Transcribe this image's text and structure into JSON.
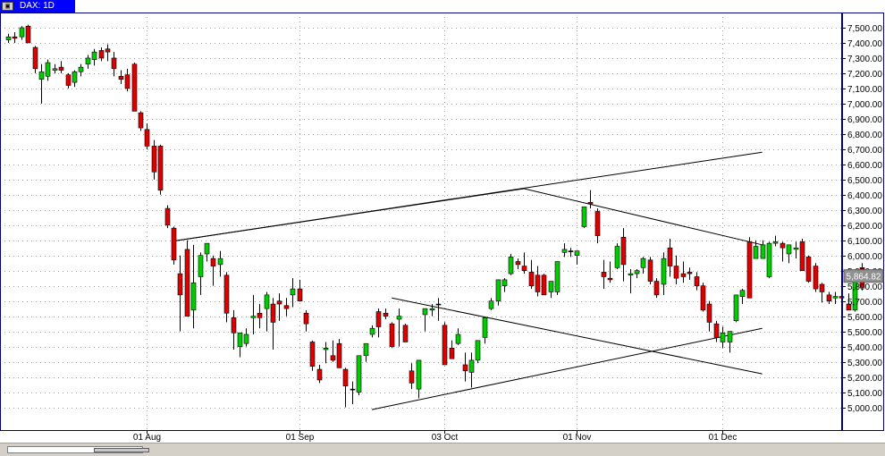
{
  "window": {
    "title": "DAX: 1D"
  },
  "chart_data": {
    "type": "candlestick",
    "title": "DAX: 1D",
    "ylim": [
      4850,
      7600
    ],
    "y_ticks": [
      5000,
      5100,
      5200,
      5300,
      5400,
      5500,
      5600,
      5700,
      5800,
      5900,
      6000,
      6100,
      6200,
      6300,
      6400,
      6500,
      6600,
      6700,
      6800,
      6900,
      7000,
      7100,
      7200,
      7300,
      7400,
      7500
    ],
    "y_tick_labels": [
      "5,000.00",
      "5,100.00",
      "5,200.00",
      "5,300.00",
      "5,400.00",
      "5,500.00",
      "5,600.00",
      "5,700.00",
      "5,800.00",
      "5,900.00",
      "6,000.00",
      "6,100.00",
      "6,200.00",
      "6,300.00",
      "6,400.00",
      "6,500.00",
      "6,600.00",
      "6,700.00",
      "6,800.00",
      "6,900.00",
      "7,000.00",
      "7,100.00",
      "7,200.00",
      "7,300.00",
      "7,400.00",
      "7,500.00"
    ],
    "x_tick_labels": [
      {
        "label": "01 Aug",
        "bar": 21
      },
      {
        "label": "01 Sep",
        "bar": 44
      },
      {
        "label": "03 Oct",
        "bar": 66
      },
      {
        "label": "01 Nov",
        "bar": 86
      },
      {
        "label": "01 Dec",
        "bar": 108
      }
    ],
    "last_price": 5864.82,
    "last_price_label": "5,864.82",
    "grid": true,
    "colors": {
      "up": "#00cc00",
      "down": "#dd0000",
      "background": "#ffffff",
      "border": "#000080",
      "grid": "#a0a0a0",
      "doji": "#000000",
      "trendline": "#000000"
    },
    "candles": [
      [
        7420,
        7460,
        7400,
        7440
      ],
      [
        7440,
        7470,
        7400,
        7430
      ],
      [
        7440,
        7510,
        7420,
        7500
      ],
      [
        7510,
        7520,
        7400,
        7400
      ],
      [
        7370,
        7380,
        7200,
        7230
      ],
      [
        7160,
        7260,
        7000,
        7210
      ],
      [
        7180,
        7290,
        7150,
        7270
      ],
      [
        7220,
        7260,
        7200,
        7230
      ],
      [
        7240,
        7280,
        7200,
        7220
      ],
      [
        7190,
        7200,
        7100,
        7120
      ],
      [
        7140,
        7220,
        7110,
        7210
      ],
      [
        7210,
        7260,
        7180,
        7240
      ],
      [
        7260,
        7320,
        7230,
        7300
      ],
      [
        7290,
        7360,
        7250,
        7340
      ],
      [
        7350,
        7370,
        7280,
        7300
      ],
      [
        7360,
        7390,
        7280,
        7340
      ],
      [
        7300,
        7340,
        7180,
        7230
      ],
      [
        7180,
        7220,
        7130,
        7160
      ],
      [
        7190,
        7230,
        7080,
        7100
      ],
      [
        7260,
        7270,
        6950,
        6950
      ],
      [
        6940,
        6950,
        6820,
        6840
      ],
      [
        6830,
        6870,
        6700,
        6720
      ],
      [
        6720,
        6760,
        6500,
        6550
      ],
      [
        6720,
        6730,
        6400,
        6430
      ],
      [
        6310,
        6330,
        6180,
        6200
      ],
      [
        6180,
        6190,
        5940,
        5970
      ],
      [
        5880,
        6000,
        5500,
        5740
      ],
      [
        6040,
        6100,
        5600,
        5600
      ],
      [
        5640,
        6070,
        5520,
        5820
      ],
      [
        5860,
        6020,
        5740,
        6000
      ],
      [
        6010,
        6050,
        5960,
        6080
      ],
      [
        5980,
        6000,
        5800,
        5930
      ],
      [
        5940,
        6030,
        5860,
        5980
      ],
      [
        5870,
        5890,
        5560,
        5620
      ],
      [
        5590,
        5640,
        5380,
        5490
      ],
      [
        5400,
        5480,
        5330,
        5490
      ],
      [
        5420,
        5520,
        5400,
        5480
      ],
      [
        5590,
        5740,
        5480,
        5600
      ],
      [
        5620,
        5680,
        5520,
        5590
      ],
      [
        5650,
        5760,
        5500,
        5740
      ],
      [
        5680,
        5720,
        5380,
        5560
      ],
      [
        5700,
        5750,
        5570,
        5680
      ],
      [
        5670,
        5720,
        5600,
        5650
      ],
      [
        5740,
        5850,
        5660,
        5780
      ],
      [
        5780,
        5840,
        5700,
        5700
      ],
      [
        5620,
        5640,
        5500,
        5550
      ],
      [
        5430,
        5440,
        5240,
        5270
      ],
      [
        5250,
        5280,
        5160,
        5180
      ],
      [
        5380,
        5430,
        5290,
        5390
      ],
      [
        5340,
        5440,
        5300,
        5310
      ],
      [
        5420,
        5450,
        5260,
        5260
      ],
      [
        5250,
        5260,
        5000,
        5140
      ],
      [
        5120,
        5170,
        5020,
        5120
      ],
      [
        5100,
        5200,
        5080,
        5340
      ],
      [
        5340,
        5410,
        5300,
        5420
      ],
      [
        5480,
        5540,
        5460,
        5520
      ],
      [
        5630,
        5650,
        5460,
        5530
      ],
      [
        5620,
        5650,
        5580,
        5600
      ],
      [
        5550,
        5560,
        5390,
        5400
      ],
      [
        5580,
        5650,
        5400,
        5600
      ],
      [
        5540,
        5550,
        5430,
        5430
      ],
      [
        5240,
        5290,
        5120,
        5160
      ],
      [
        5120,
        5300,
        5060,
        5310
      ],
      [
        5610,
        5650,
        5500,
        5650
      ],
      [
        5640,
        5680,
        5600,
        5650
      ],
      [
        5680,
        5720,
        5570,
        5680
      ],
      [
        5540,
        5560,
        5280,
        5280
      ],
      [
        5390,
        5440,
        5320,
        5320
      ],
      [
        5420,
        5520,
        5410,
        5480
      ],
      [
        5280,
        5360,
        5170,
        5240
      ],
      [
        5230,
        5360,
        5130,
        5310
      ],
      [
        5310,
        5420,
        5290,
        5440
      ],
      [
        5460,
        5560,
        5420,
        5590
      ],
      [
        5650,
        5720,
        5640,
        5700
      ],
      [
        5700,
        5840,
        5670,
        5840
      ],
      [
        5800,
        5850,
        5760,
        5840
      ],
      [
        5880,
        6010,
        5870,
        5990
      ],
      [
        5960,
        5980,
        5910,
        5940
      ],
      [
        5930,
        6020,
        5880,
        5900
      ],
      [
        5890,
        5970,
        5780,
        5800
      ],
      [
        5870,
        5930,
        5730,
        5760
      ],
      [
        5870,
        5880,
        5740,
        5740
      ],
      [
        5760,
        5830,
        5720,
        5830
      ],
      [
        5760,
        5960,
        5740,
        5960
      ],
      [
        6020,
        6080,
        5990,
        6040
      ],
      [
        6030,
        6050,
        5990,
        6030
      ],
      [
        6000,
        6030,
        5940,
        6030
      ],
      [
        6190,
        6320,
        6180,
        6320
      ],
      [
        6350,
        6430,
        6310,
        6340
      ],
      [
        6290,
        6310,
        6080,
        6130
      ],
      [
        5890,
        5970,
        5780,
        5860
      ],
      [
        5850,
        5960,
        5820,
        5840
      ],
      [
        5920,
        6080,
        5910,
        6060
      ],
      [
        6120,
        6180,
        5830,
        5940
      ],
      [
        5870,
        5910,
        5750,
        5880
      ],
      [
        5880,
        5910,
        5850,
        5900
      ],
      [
        5920,
        5990,
        5880,
        5980
      ],
      [
        5970,
        5990,
        5810,
        5830
      ],
      [
        5830,
        5850,
        5720,
        5740
      ],
      [
        5810,
        6020,
        5740,
        5980
      ],
      [
        6050,
        6110,
        5860,
        5930
      ],
      [
        5930,
        6000,
        5810,
        5850
      ],
      [
        5880,
        5960,
        5820,
        5860
      ],
      [
        5890,
        5920,
        5840,
        5880
      ],
      [
        5860,
        5890,
        5770,
        5800
      ],
      [
        5800,
        5820,
        5630,
        5640
      ],
      [
        5680,
        5700,
        5500,
        5560
      ],
      [
        5550,
        5570,
        5430,
        5460
      ],
      [
        5430,
        5530,
        5390,
        5490
      ],
      [
        5430,
        5500,
        5360,
        5500
      ],
      [
        5570,
        5740,
        5560,
        5740
      ],
      [
        5730,
        5780,
        5680,
        5770
      ],
      [
        6090,
        6120,
        5720,
        5720
      ],
      [
        5980,
        6100,
        5980,
        6060
      ],
      [
        5980,
        6100,
        5980,
        6070
      ],
      [
        5860,
        6090,
        5850,
        6080
      ],
      [
        6080,
        6130,
        6060,
        6090
      ],
      [
        6080,
        6090,
        5960,
        6050
      ],
      [
        6010,
        6050,
        5950,
        6070
      ],
      [
        6040,
        6090,
        5980,
        6050
      ],
      [
        6090,
        6110,
        5900,
        5900
      ],
      [
        5990,
        6000,
        5820,
        5830
      ],
      [
        5930,
        5950,
        5760,
        5780
      ],
      [
        5810,
        5820,
        5690,
        5760
      ],
      [
        5740,
        5760,
        5680,
        5700
      ],
      [
        5720,
        5760,
        5680,
        5730
      ],
      [
        5730,
        5760,
        5690,
        5720
      ],
      [
        5680,
        5750,
        5650,
        5640
      ],
      [
        5640,
        5830,
        5630,
        5840
      ],
      [
        5920,
        5950,
        5770,
        5790
      ],
      [
        5860,
        5880,
        5830,
        5860
      ]
    ],
    "trendlines": [
      [
        25,
        6095,
        78,
        6440
      ],
      [
        78,
        6440,
        114,
        6070
      ],
      [
        58,
        5720,
        114,
        5220
      ],
      [
        55,
        4985,
        114,
        5520
      ],
      [
        25,
        6095,
        114,
        6680
      ]
    ]
  }
}
